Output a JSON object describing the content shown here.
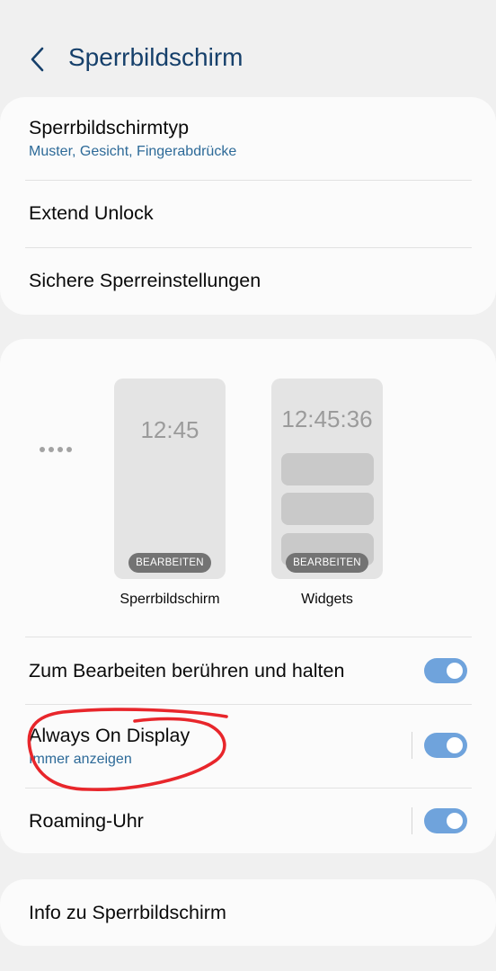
{
  "header": {
    "title": "Sperrbildschirm",
    "back_icon": "chevron-left-icon"
  },
  "security_card": {
    "items": [
      {
        "title": "Sperrbildschirmtyp",
        "subtitle": "Muster, Gesicht, Fingerabdrücke"
      },
      {
        "title": "Extend Unlock"
      },
      {
        "title": "Sichere Sperreinstellungen"
      }
    ]
  },
  "preview_card": {
    "previews": [
      {
        "time": "12:45",
        "badge": "BEARBEITEN",
        "label": "Sperrbildschirm"
      },
      {
        "time": "12:45:36",
        "badge": "BEARBEITEN",
        "label": "Widgets"
      }
    ],
    "settings": [
      {
        "title": "Zum Bearbeiten berühren und halten",
        "enabled": true
      },
      {
        "title": "Always On Display",
        "subtitle": "Immer anzeigen",
        "enabled": true
      },
      {
        "title": "Roaming-Uhr",
        "enabled": true
      }
    ]
  },
  "info_card": {
    "title": "Info zu Sperrbildschirm"
  },
  "colors": {
    "accent": "#6fa3dc",
    "title": "#16406b",
    "subtitle": "#2d6a98",
    "annotation": "#e8262b"
  }
}
